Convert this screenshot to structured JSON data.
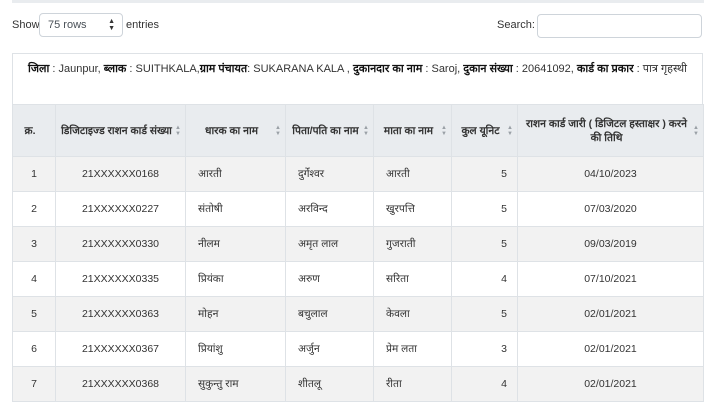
{
  "controls": {
    "show_label": "Show",
    "rows_value": "75 rows",
    "entries_label": "entries",
    "search_label": "Search:",
    "search_value": ""
  },
  "info": {
    "district_label": "जिला",
    "district_value": " : Jaunpur, ",
    "block_label": "ब्लाक",
    "block_value": " : SUITHKALA,",
    "panchayat_label": "ग्राम पंचायत",
    "panchayat_value": ": SUKARANA KALA , ",
    "dealer_label": "दुकानदार का नाम",
    "dealer_value": " : Saroj, ",
    "shop_label": "दुकान संख्या",
    "shop_value": " : 20641092, ",
    "card_type_label": "कार्ड का प्रकार",
    "card_type_value": " : पात्र गृहस्थी"
  },
  "table": {
    "headers": {
      "sno": "क्र.",
      "card": "डिजिटाइज्ड राशन कार्ड संख्या",
      "name": "धारक का नाम",
      "father": "पिता/पति का नाम",
      "mother": "माता का नाम",
      "units": "कुल यूनिट",
      "date": "राशन कार्ड जारी ( डिजिटल हस्ताक्षर ) करने की तिथि"
    },
    "rows": [
      {
        "sno": "1",
        "card": "21XXXXXX0168",
        "name": "आरती",
        "father": "दुर्गेश्वर",
        "mother": "आरती",
        "units": "5",
        "date": "04/10/2023"
      },
      {
        "sno": "2",
        "card": "21XXXXXX0227",
        "name": "संतोषी",
        "father": "अरविन्द",
        "mother": "खुरपत्ति",
        "units": "5",
        "date": "07/03/2020"
      },
      {
        "sno": "3",
        "card": "21XXXXXX0330",
        "name": "नीलम",
        "father": "अमृत लाल",
        "mother": "गुजराती",
        "units": "5",
        "date": "09/03/2019"
      },
      {
        "sno": "4",
        "card": "21XXXXXX0335",
        "name": "प्रियंका",
        "father": "अरुण",
        "mother": "सरिता",
        "units": "4",
        "date": "07/10/2021"
      },
      {
        "sno": "5",
        "card": "21XXXXXX0363",
        "name": "मोहन",
        "father": "बचुलाल",
        "mother": "केवला",
        "units": "5",
        "date": "02/01/2021"
      },
      {
        "sno": "6",
        "card": "21XXXXXX0367",
        "name": "प्रियांशु",
        "father": "अर्जुन",
        "mother": "प्रेम लता",
        "units": "3",
        "date": "02/01/2021"
      },
      {
        "sno": "7",
        "card": "21XXXXXX0368",
        "name": "सुकुन्तु राम",
        "father": "शीतलू",
        "mother": "रीता",
        "units": "4",
        "date": "02/01/2021"
      }
    ]
  }
}
